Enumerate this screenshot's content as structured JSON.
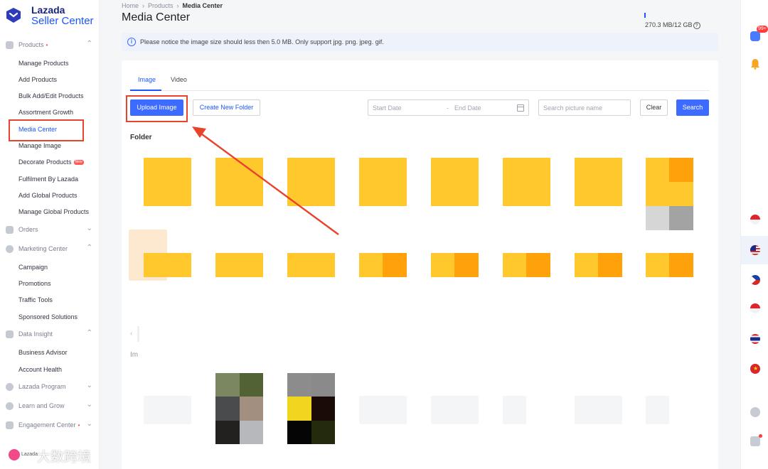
{
  "brand": {
    "line1": "Lazada",
    "line2": "Seller Center"
  },
  "sidebar": {
    "sections": [
      {
        "label": "Products",
        "dot": "•",
        "chevron": "⌃"
      },
      {
        "label": "Orders",
        "chevron": "⌄"
      },
      {
        "label": "Marketing Center",
        "chevron": "⌃"
      },
      {
        "label": "Data Insight",
        "chevron": "⌃"
      },
      {
        "label": "Lazada Program",
        "chevron": "⌄"
      },
      {
        "label": "Learn and Grow",
        "chevron": "⌄"
      },
      {
        "label": "Engagement Center",
        "dot": "•",
        "chevron": "⌄"
      }
    ],
    "products_items": [
      "Manage Products",
      "Add Products",
      "Bulk Add/Edit Products",
      "Assortment Growth",
      "Media Center",
      "Manage Image",
      "Decorate Products",
      "Fulfilment By Lazada",
      "Add Global Products",
      "Manage Global Products"
    ],
    "new_badge": "New",
    "marketing_items": [
      "Campaign",
      "Promotions",
      "Traffic Tools",
      "Sponsored Solutions"
    ],
    "insight_items": [
      "Business Advisor",
      "Account Health"
    ]
  },
  "breadcrumb": {
    "home": "Home",
    "products": "Products",
    "current": "Media Center",
    "separator": "›"
  },
  "page_title": "Media Center",
  "storage": {
    "text": "270.3 MB/12 GB",
    "help": "?",
    "used_fraction": 0.022
  },
  "notice": {
    "icon": "i",
    "text": "Please notice the image size should less then 5.0 MB. Only support jpg. png. jpeg. gif."
  },
  "tabs": [
    {
      "label": "Image",
      "active": true
    },
    {
      "label": "Video",
      "active": false
    }
  ],
  "toolbar": {
    "upload_label": "Upload Image",
    "new_folder_label": "Create New Folder",
    "start_date_placeholder": "Start Date",
    "end_date_placeholder": "End Date",
    "date_separator": "-",
    "search_placeholder": "Search picture name",
    "clear_label": "Clear",
    "search_label": "Search"
  },
  "folder_section": {
    "label": "Folder"
  },
  "images_section": {
    "label": "Im"
  },
  "pager": {
    "prev": "‹"
  },
  "rail": {
    "badge": "99+"
  },
  "watermark": {
    "text": "大数跨境",
    "logo_text": "Lazada"
  },
  "colors": {
    "accent": "#3d6bff",
    "highlight": "#e8442c",
    "folder_yellow": "#ffc82c",
    "folder_orange": "#ffa10a"
  }
}
